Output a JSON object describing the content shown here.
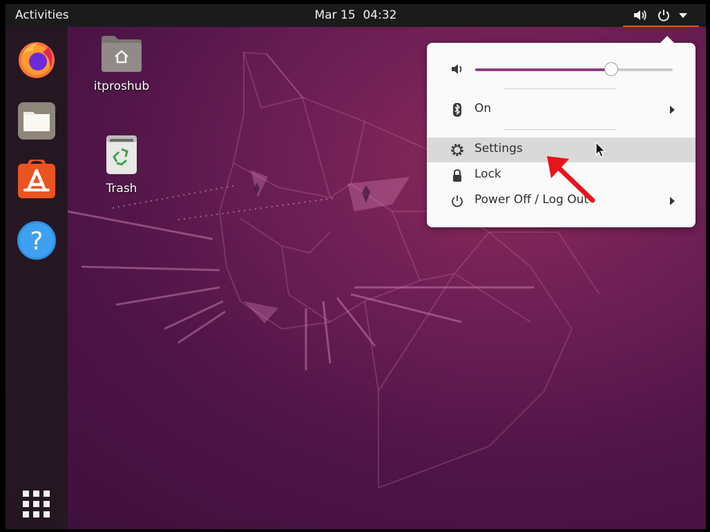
{
  "topbar": {
    "activities_label": "Activities",
    "date": "Mar 15",
    "time": "04:32",
    "accent_color": "#e95420"
  },
  "dock": {
    "items": [
      {
        "name": "Firefox",
        "icon": "firefox-icon"
      },
      {
        "name": "Files",
        "icon": "files-icon"
      },
      {
        "name": "Ubuntu Software",
        "icon": "software-icon"
      },
      {
        "name": "Help",
        "icon": "help-icon"
      }
    ],
    "apps_grid_icon": "show-applications-icon"
  },
  "desktop": {
    "icons": [
      {
        "label": "itproshub",
        "icon": "home-folder-icon"
      },
      {
        "label": "Trash",
        "icon": "trash-icon"
      }
    ]
  },
  "system_menu": {
    "volume_level": 0.69,
    "bluetooth_label": "On",
    "settings_label": "Settings",
    "lock_label": "Lock",
    "power_label": "Power Off / Log Out",
    "highlighted_item": "Settings"
  },
  "colors": {
    "slider_fill": "#8e3c7e",
    "highlight": "#d9d9d9",
    "annotation_arrow": "#e8141b",
    "wallpaper_dark": "#3d0f3a",
    "wallpaper_light": "#8e2a5a"
  }
}
